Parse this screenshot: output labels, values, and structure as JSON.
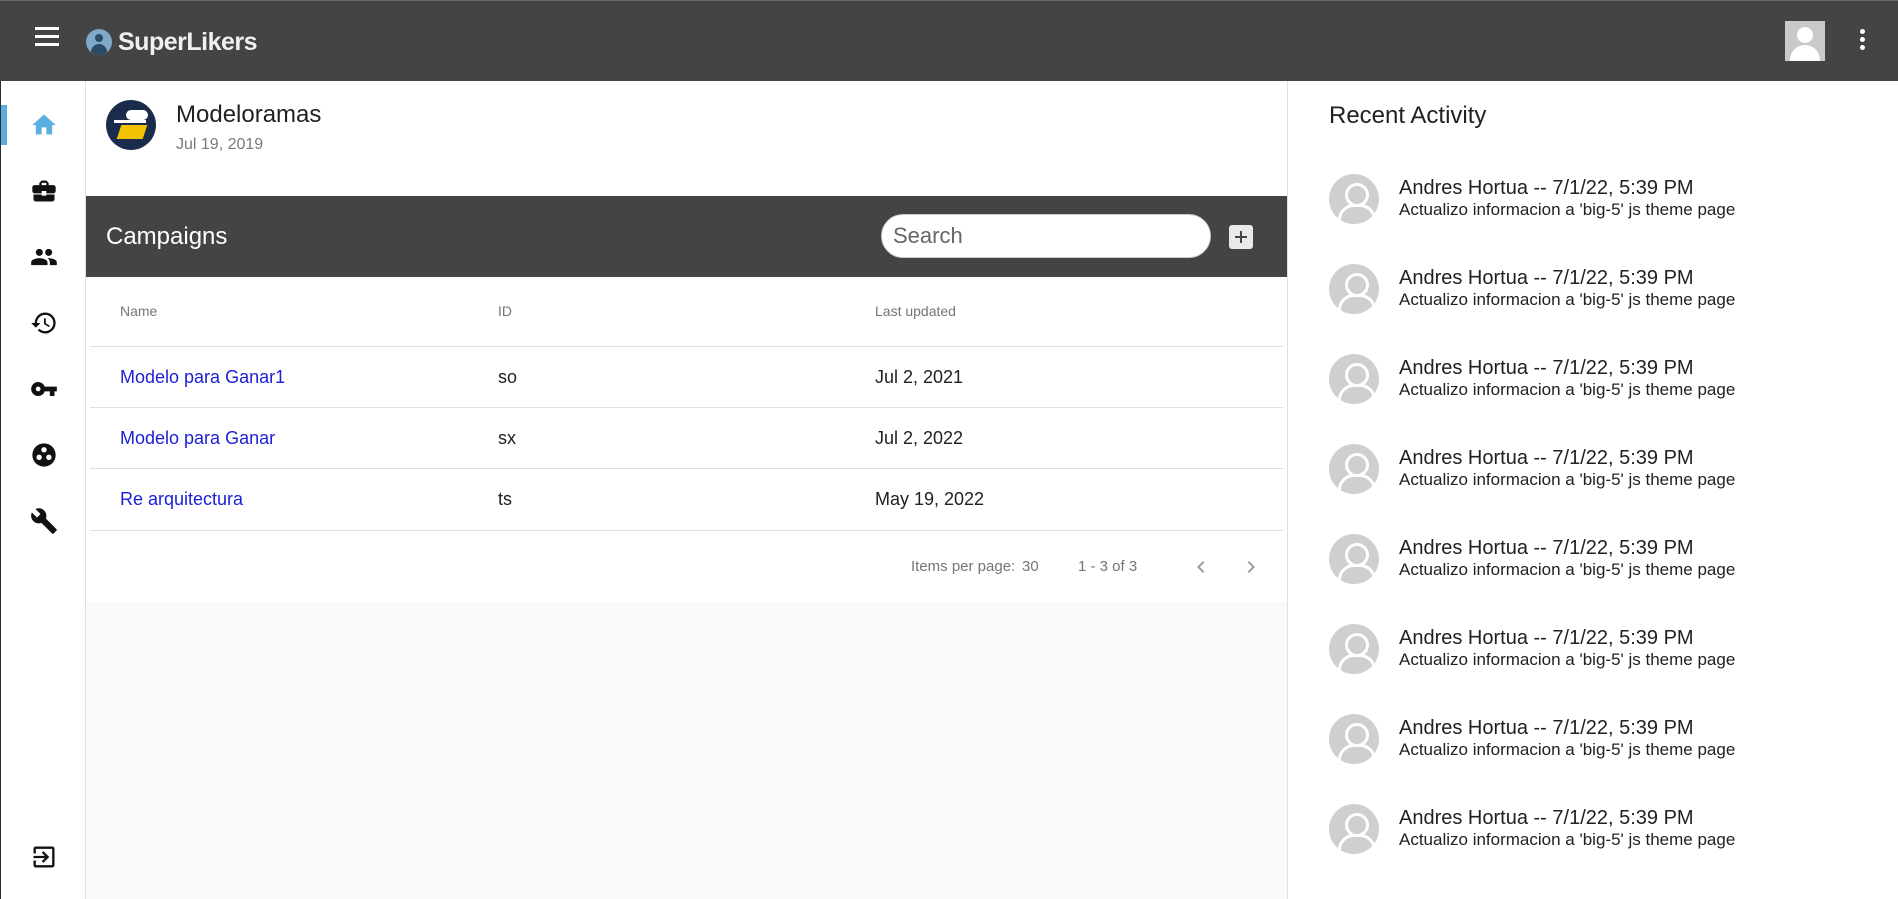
{
  "app": {
    "name": "SuperLikers"
  },
  "topbar": {
    "menu_icon": "hamburger-menu-icon",
    "avatar_icon": "user-avatar-icon",
    "more_icon": "more-vert-icon"
  },
  "sidebar": {
    "items": [
      {
        "icon": "home-icon",
        "active": true
      },
      {
        "icon": "briefcase-icon",
        "active": false
      },
      {
        "icon": "people-icon",
        "active": false
      },
      {
        "icon": "history-icon",
        "active": false
      },
      {
        "icon": "key-icon",
        "active": false
      },
      {
        "icon": "palette-icon",
        "active": false
      },
      {
        "icon": "wrench-icon",
        "active": false
      },
      {
        "icon": "logout-icon",
        "active": false
      }
    ],
    "accent_color": "#5aaee0"
  },
  "org": {
    "name": "Modeloramas",
    "date": "Jul 19, 2019"
  },
  "campaigns": {
    "title": "Campaigns",
    "search_placeholder": "Search",
    "columns": [
      "Name",
      "ID",
      "Last updated"
    ],
    "rows": [
      {
        "name": "Modelo para Ganar1",
        "id": "so",
        "updated": "Jul 2, 2021"
      },
      {
        "name": "Modelo para Ganar",
        "id": "sx",
        "updated": "Jul 2, 2022"
      },
      {
        "name": "Re arquitectura",
        "id": "ts",
        "updated": "May 19, 2022"
      }
    ],
    "pagination": {
      "items_per_page_label": "Items per page:",
      "items_per_page": "30",
      "range": "1 - 3 of 3"
    }
  },
  "recent_activity": {
    "title": "Recent Activity",
    "items": [
      {
        "title": "Andres Hortua -- 7/1/22, 5:39 PM",
        "desc": "Actualizo informacion a 'big-5' js theme page"
      },
      {
        "title": "Andres Hortua -- 7/1/22, 5:39 PM",
        "desc": "Actualizo informacion a 'big-5' js theme page"
      },
      {
        "title": "Andres Hortua -- 7/1/22, 5:39 PM",
        "desc": "Actualizo informacion a 'big-5' js theme page"
      },
      {
        "title": "Andres Hortua -- 7/1/22, 5:39 PM",
        "desc": "Actualizo informacion a 'big-5' js theme page"
      },
      {
        "title": "Andres Hortua -- 7/1/22, 5:39 PM",
        "desc": "Actualizo informacion a 'big-5' js theme page"
      },
      {
        "title": "Andres Hortua -- 7/1/22, 5:39 PM",
        "desc": "Actualizo informacion a 'big-5' js theme page"
      },
      {
        "title": "Andres Hortua -- 7/1/22, 5:39 PM",
        "desc": "Actualizo informacion a 'big-5' js theme page"
      },
      {
        "title": "Andres Hortua -- 7/1/22, 5:39 PM",
        "desc": "Actualizo informacion a 'big-5' js theme page"
      }
    ]
  }
}
